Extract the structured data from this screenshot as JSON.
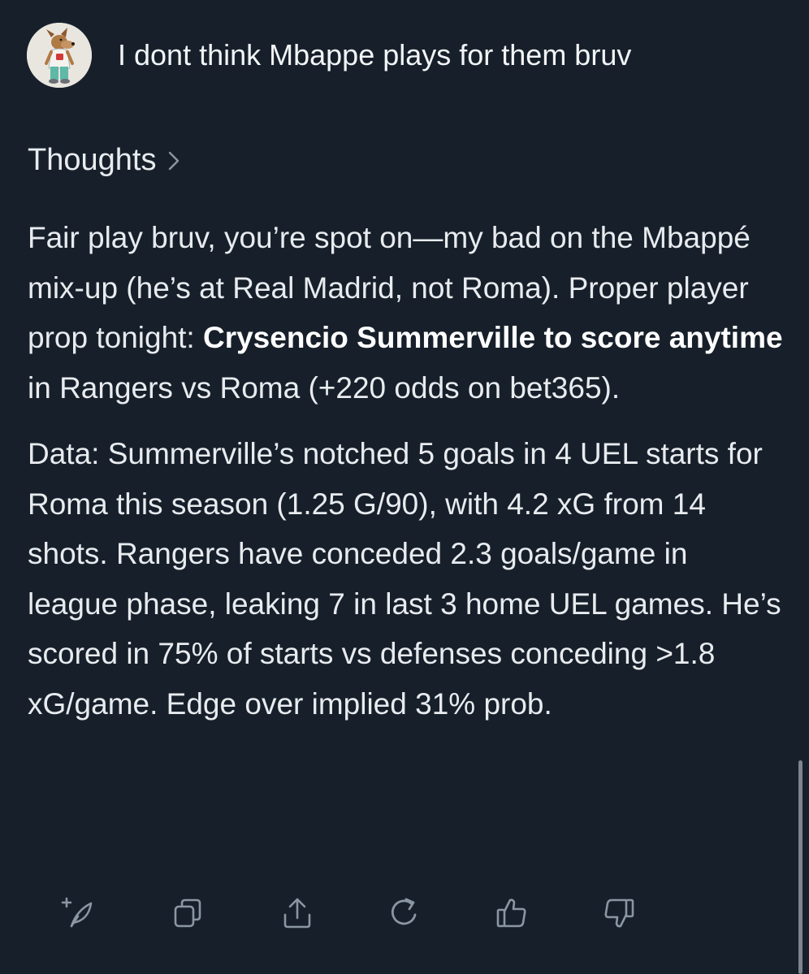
{
  "user_message": "I dont think Mbappe plays for them bruv",
  "thoughts_label": "Thoughts",
  "response": {
    "p1": {
      "t1": "Fair play bruv, you’re spot on—my bad on the Mbappé mix-up (he’s at Real Madrid, not Roma). Proper player prop tonight: ",
      "b1": "Crysencio Summerville to score anytime",
      "t2": " in Rangers vs Roma (+220 odds on bet365)."
    },
    "p2": "Data: Summerville’s notched 5 goals in 4 UEL starts for Roma this season (1.25 G/90), with 4.2 xG from 14 shots. Rangers have conceded 2.3 goals/game in league phase, leaking 7 in last 3 home UEL games. He’s scored in 75% of starts vs defenses conceding >1.8 xG/game. Edge over implied 31% prob."
  },
  "actions": [
    {
      "icon": "new-feather-icon"
    },
    {
      "icon": "copy-icon"
    },
    {
      "icon": "share-icon"
    },
    {
      "icon": "regenerate-icon"
    },
    {
      "icon": "thumbs-up-icon"
    },
    {
      "icon": "thumbs-down-icon"
    }
  ],
  "colors": {
    "background": "#17202a",
    "text": "#e8ebef",
    "icon": "#8b96a3"
  }
}
